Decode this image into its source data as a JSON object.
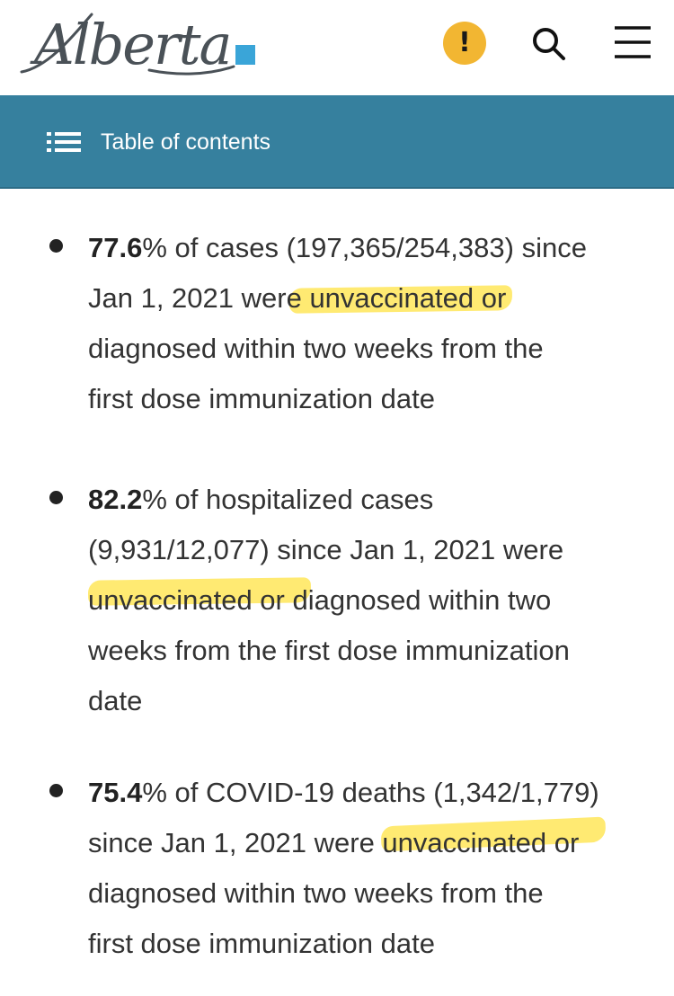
{
  "header": {
    "logo_text": "Alberta",
    "alert_symbol": "!",
    "icons": [
      "alert-icon",
      "search-icon",
      "hamburger-menu-icon"
    ],
    "alert_color": "#f2b632",
    "logo_accent_color": "#3aa5d8"
  },
  "toc": {
    "label": "Table of contents",
    "icon": "list-icon",
    "background_color": "#36809e"
  },
  "highlight_color": "#ffe23c",
  "items": [
    {
      "lines": [
        {
          "bold": "77.6",
          "text": "% of cases (197,365/254,383) since"
        },
        {
          "text": "Jan 1, 2021 were unvaccinated or"
        },
        {
          "text": "diagnosed within two weeks from the"
        },
        {
          "text": "first dose immunization date"
        }
      ],
      "highlighted": "unvaccinated or"
    },
    {
      "lines": [
        {
          "bold": "82.2",
          "text": "% of hospitalized cases"
        },
        {
          "text": "(9,931/12,077) since Jan 1, 2021 were"
        },
        {
          "text": "unvaccinated or diagnosed within two"
        },
        {
          "text": "weeks from the first dose immunization"
        },
        {
          "text": "date"
        }
      ],
      "highlighted": "unvaccinated or"
    },
    {
      "lines": [
        {
          "bold": "75.4",
          "text": "% of COVID-19 deaths (1,342/1,779)"
        },
        {
          "text": "since Jan 1, 2021 were unvaccinated or"
        },
        {
          "text": "diagnosed within two weeks from the"
        },
        {
          "text": "first dose immunization date"
        }
      ],
      "highlighted": "unvaccinated or"
    }
  ]
}
